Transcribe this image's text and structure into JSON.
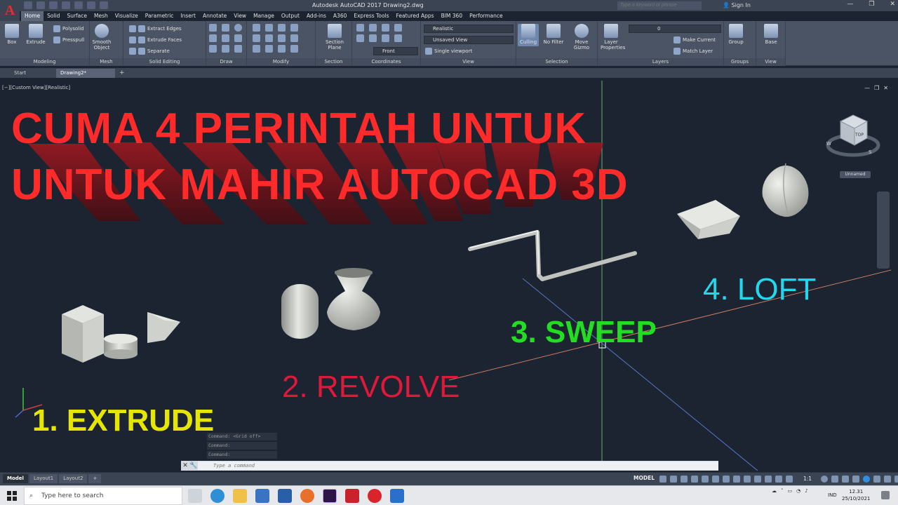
{
  "app": {
    "logo_letter": "A",
    "window_title": "Autodesk AutoCAD 2017    Drawing2.dwg",
    "search_placeholder": "Type a keyword or phrase",
    "sign_in": "Sign In"
  },
  "ribbon_tabs": [
    "Home",
    "Solid",
    "Surface",
    "Mesh",
    "Visualize",
    "Parametric",
    "Insert",
    "Annotate",
    "View",
    "Manage",
    "Output",
    "Add-ins",
    "A360",
    "Express Tools",
    "Featured Apps",
    "BIM 360",
    "Performance"
  ],
  "ribbon": {
    "modeling": {
      "title": "Modeling",
      "box": "Box",
      "extrude": "Extrude",
      "polysolid": "Polysolid",
      "presspull": "Presspull"
    },
    "mesh": {
      "title": "Mesh",
      "smooth_object": "Smooth Object"
    },
    "solid_editing": {
      "title": "Solid Editing",
      "extract_edges": "Extract Edges",
      "extrude_faces": "Extrude Faces",
      "separate": "Separate"
    },
    "draw": {
      "title": "Draw"
    },
    "modify": {
      "title": "Modify"
    },
    "section": {
      "title": "Section",
      "section_plane": "Section Plane"
    },
    "coordinates": {
      "title": "Coordinates",
      "front": "Front"
    },
    "view": {
      "title": "View",
      "visual_style": "Realistic",
      "named_view": "Unsaved View",
      "viewport": "Single viewport"
    },
    "selection": {
      "title": "Selection",
      "culling": "Culling",
      "no_filter": "No Filter",
      "move_gizmo": "Move Gizmo"
    },
    "layers": {
      "title": "Layers",
      "layer_properties": "Layer Properties",
      "current_layer": "0",
      "make_current": "Make Current",
      "match_layer": "Match Layer"
    },
    "groups": {
      "title": "Groups",
      "group": "Group"
    },
    "view2": {
      "title": "View",
      "base": "Base"
    }
  },
  "file_tabs": [
    "Start",
    "Drawing2*"
  ],
  "viewport": {
    "label": "[−][Custom View][Realistic]",
    "headline_1": "CUMA 4 PERINTAH UNTUK",
    "headline_2": "UNTUK MAHIR AUTOCAD 3D",
    "label_extrude": "1. EXTRUDE",
    "label_revolve": "2. REVOLVE",
    "label_sweep": "3. SWEEP",
    "label_loft": "4. LOFT",
    "viewcube_top": "TOP",
    "compass_w": "W",
    "compass_s": "S",
    "ucs_name": "Unnamed",
    "colors": {
      "headline": "#ff2a2a",
      "extrude": "#e6e600",
      "revolve": "#e0183a",
      "sweep": "#22dd22",
      "loft": "#22d8ee"
    }
  },
  "command": {
    "history": [
      "Command:  <Grid off>",
      "Command:",
      "Command:"
    ],
    "placeholder": "Type a command"
  },
  "layout_tabs": [
    "Model",
    "Layout1",
    "Layout2"
  ],
  "status": {
    "model": "MODEL",
    "scale": "1:1"
  },
  "taskbar": {
    "search_placeholder": "Type here to search",
    "language": "IND",
    "time": "12.31",
    "date": "25/10/2021"
  }
}
